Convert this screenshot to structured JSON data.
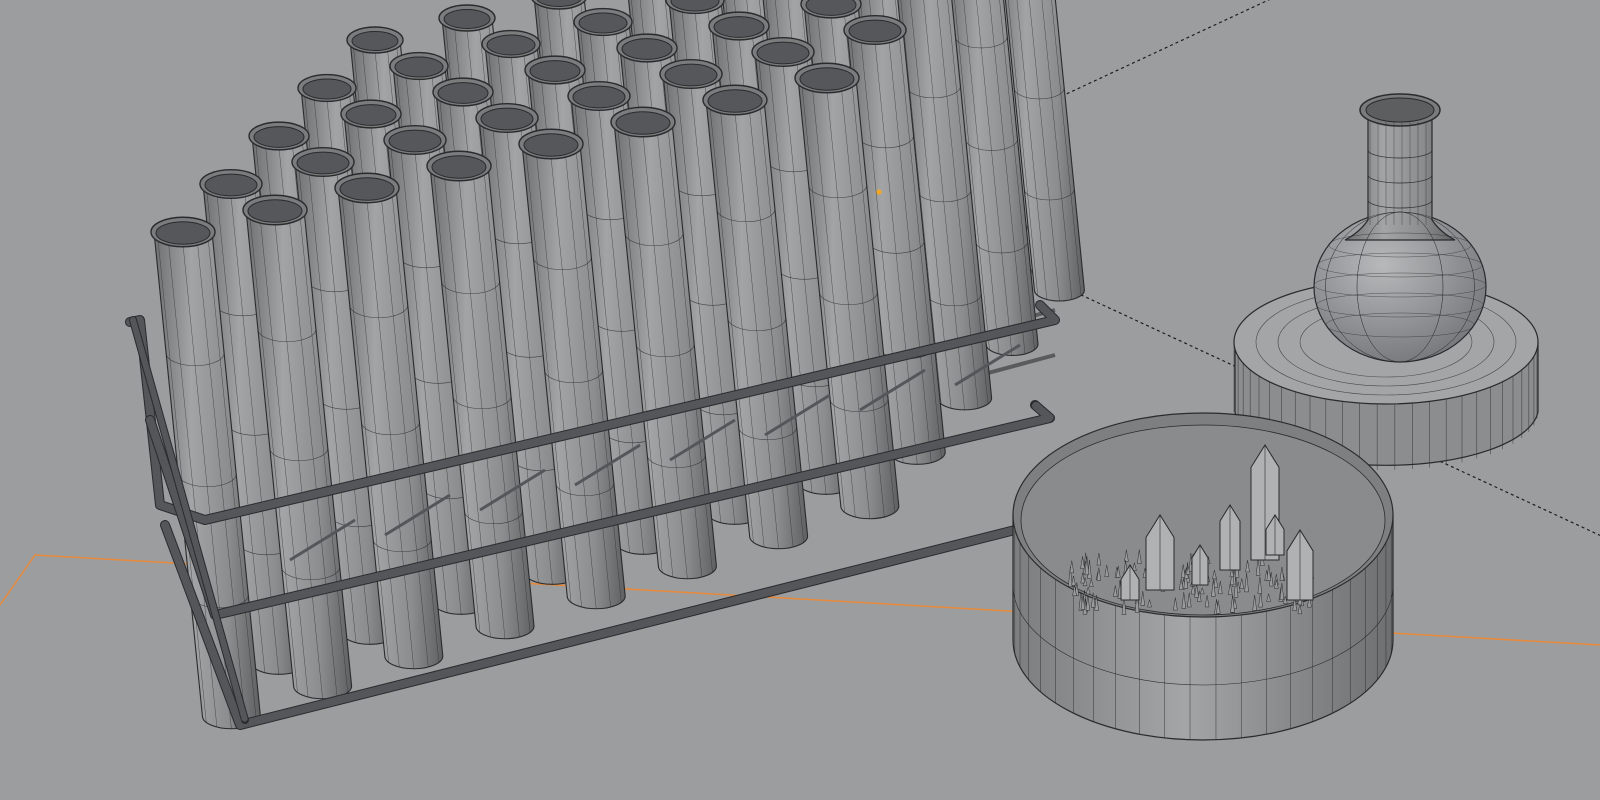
{
  "viewport": {
    "mode": "wireframe-on-solid",
    "background_color": "#9c9d9f",
    "mesh_color": "#8f9092",
    "wire_color": "#2a2b2c",
    "rod_color": "#4a4b4d",
    "x_axis_color": "#e8893a",
    "selected_origin_color": "#f5a623"
  },
  "objects": [
    {
      "name": "test-tube-rack",
      "icon": "rack-icon"
    },
    {
      "name": "test-tubes",
      "count": 40
    },
    {
      "name": "round-bottom-flask",
      "icon": "flask-icon"
    },
    {
      "name": "flask-stand-base",
      "icon": "cylinder-icon"
    },
    {
      "name": "crystal-dish",
      "icon": "bowl-icon"
    },
    {
      "name": "crystal-cluster",
      "icon": "crystal-icon"
    }
  ]
}
